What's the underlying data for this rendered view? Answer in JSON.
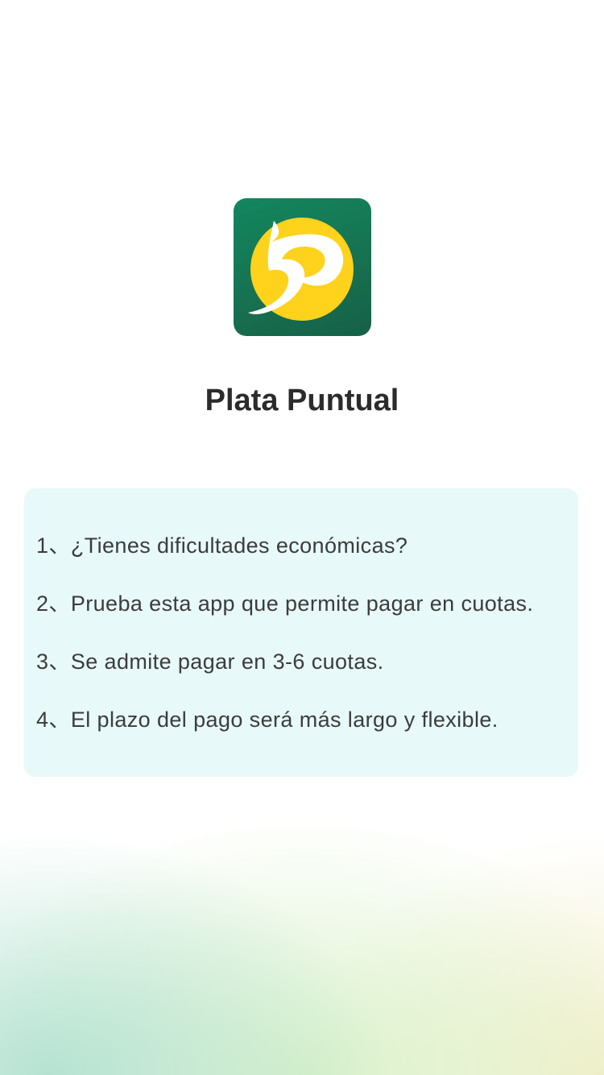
{
  "app": {
    "name": "Plata Puntual",
    "logo_icon": "plata-puntual-logo-icon",
    "colors": {
      "logo_background": "#17704f",
      "logo_circle": "#ffd21c",
      "card_background": "#e7f9f8",
      "text": "#3c3c3c"
    }
  },
  "info": {
    "items": [
      "1、¿Tienes dificultades económicas?",
      "2、Prueba esta app que permite pagar en cuotas.",
      "3、Se admite pagar en 3-6 cuotas.",
      "4、El plazo del pago será más largo y flexible."
    ]
  }
}
